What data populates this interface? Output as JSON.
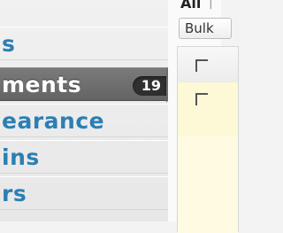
{
  "sidebar": {
    "items": [
      {
        "label": "s"
      },
      {
        "label": "ments",
        "count": "19"
      },
      {
        "label": "earance"
      },
      {
        "label": "ins"
      },
      {
        "label": "rs"
      }
    ]
  },
  "main": {
    "filter_all": "All",
    "filter_sep": "|",
    "bulk_select": "Bulk"
  },
  "colors": {
    "link_blue": "#2b7fb3",
    "active_bg": "#6a6a6a",
    "badge_bg": "#2f2f2f",
    "row_highlight": "#fdf8d6"
  }
}
